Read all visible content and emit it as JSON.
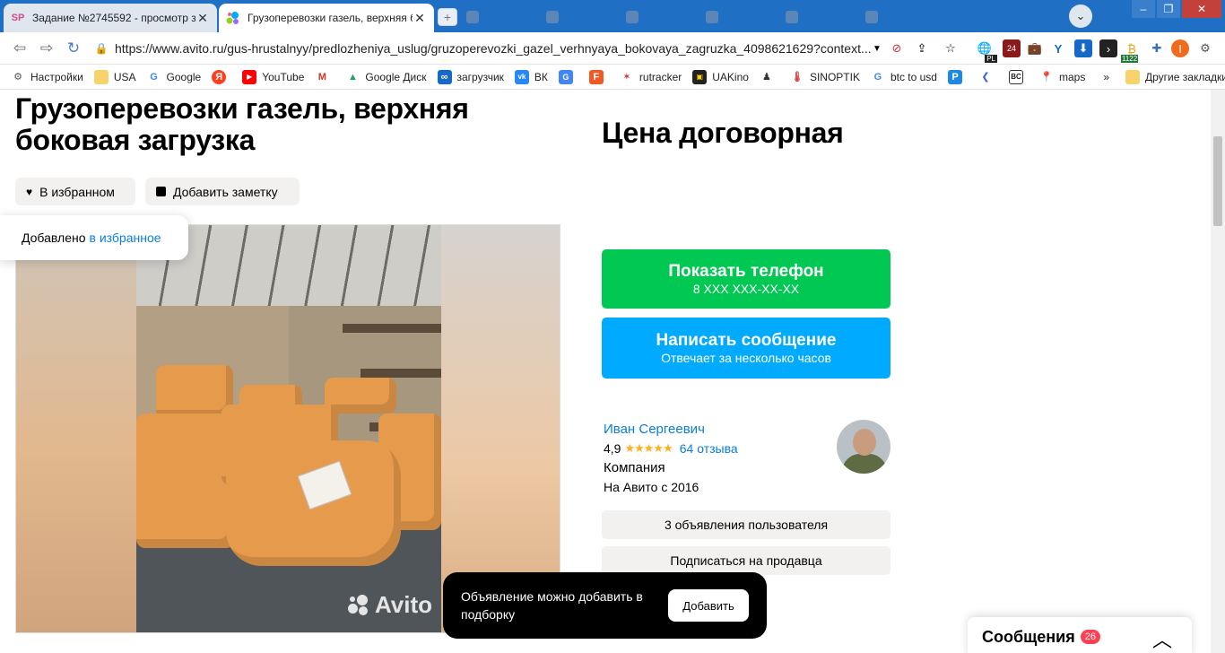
{
  "browser": {
    "tabs": [
      {
        "title": "Задание №2745592 - просмотр за",
        "favicon": "SP",
        "active": false
      },
      {
        "title": "Грузоперевозки газель, верхняя б",
        "favicon": "avito-icon",
        "active": true
      }
    ],
    "url": "https://www.avito.ru/gus-hrustalnyy/predlozheniya_uslug/gruzoperevozki_gazel_verhnyaya_bokovaya_zagruzka_4098621629?context...",
    "ext_badges": {
      "pl": "PL",
      "n24": "24",
      "num": "1122"
    },
    "profile_letter": "I",
    "bookmarks": [
      {
        "label": "Настройки",
        "icon": "gear-icon"
      },
      {
        "label": "USA",
        "icon": "folder-icon"
      },
      {
        "label": "Google",
        "icon": "google-icon"
      },
      {
        "label": "",
        "icon": "yandex-icon"
      },
      {
        "label": "YouTube",
        "icon": "youtube-icon"
      },
      {
        "label": "",
        "icon": "gmail-icon"
      },
      {
        "label": "Google Диск",
        "icon": "drive-icon"
      },
      {
        "label": "загрузчик",
        "icon": "infinity-icon"
      },
      {
        "label": "ВК",
        "icon": "vk-icon"
      },
      {
        "label": "",
        "icon": "translate-icon"
      },
      {
        "label": "",
        "icon": "f-icon"
      },
      {
        "label": "rutracker",
        "icon": "rutracker-icon"
      },
      {
        "label": "UAKino",
        "icon": "uakino-icon"
      },
      {
        "label": "",
        "icon": "figure-icon"
      },
      {
        "label": "SINOPTIK",
        "icon": "thermometer-icon"
      },
      {
        "label": "btc to usd",
        "icon": "google-icon"
      },
      {
        "label": "",
        "icon": "p-icon"
      },
      {
        "label": "",
        "icon": "arrow-icon"
      },
      {
        "label": "",
        "icon": "bc-icon"
      },
      {
        "label": "maps",
        "icon": "maps-icon"
      }
    ],
    "more": "»",
    "other_bookmarks": "Другие закладки"
  },
  "listing": {
    "title": "Грузоперевозки газель, верхняя боковая загрузка",
    "price": "Цена договорная",
    "favorite_label": "В избранном",
    "note_label": "Добавить заметку",
    "toast_text": "Добавлено",
    "toast_link": "в избранное",
    "watermark": "Avito"
  },
  "contact": {
    "phone_title": "Показать телефон",
    "phone_masked": "8 XXX XXX-XX-XX",
    "message_title": "Написать сообщение",
    "message_sub": "Отвечает за несколько часов"
  },
  "seller": {
    "name": "Иван Сергеевич",
    "rating": "4,9",
    "stars": "★★★★★",
    "reviews": "64 отзыва",
    "type": "Компания",
    "since": "На Авито с 2016",
    "ads_button": "3 объявления пользователя",
    "subscribe_button": "Подписаться на продавца"
  },
  "snackbar": {
    "text": "Объявление можно добавить в подборку",
    "button": "Добавить"
  },
  "messages": {
    "title": "Сообщения",
    "count": "26"
  },
  "colors": {
    "green": "#00c853",
    "blue": "#00aaff",
    "link": "#0a7ee0",
    "badge": "#ff4053"
  }
}
